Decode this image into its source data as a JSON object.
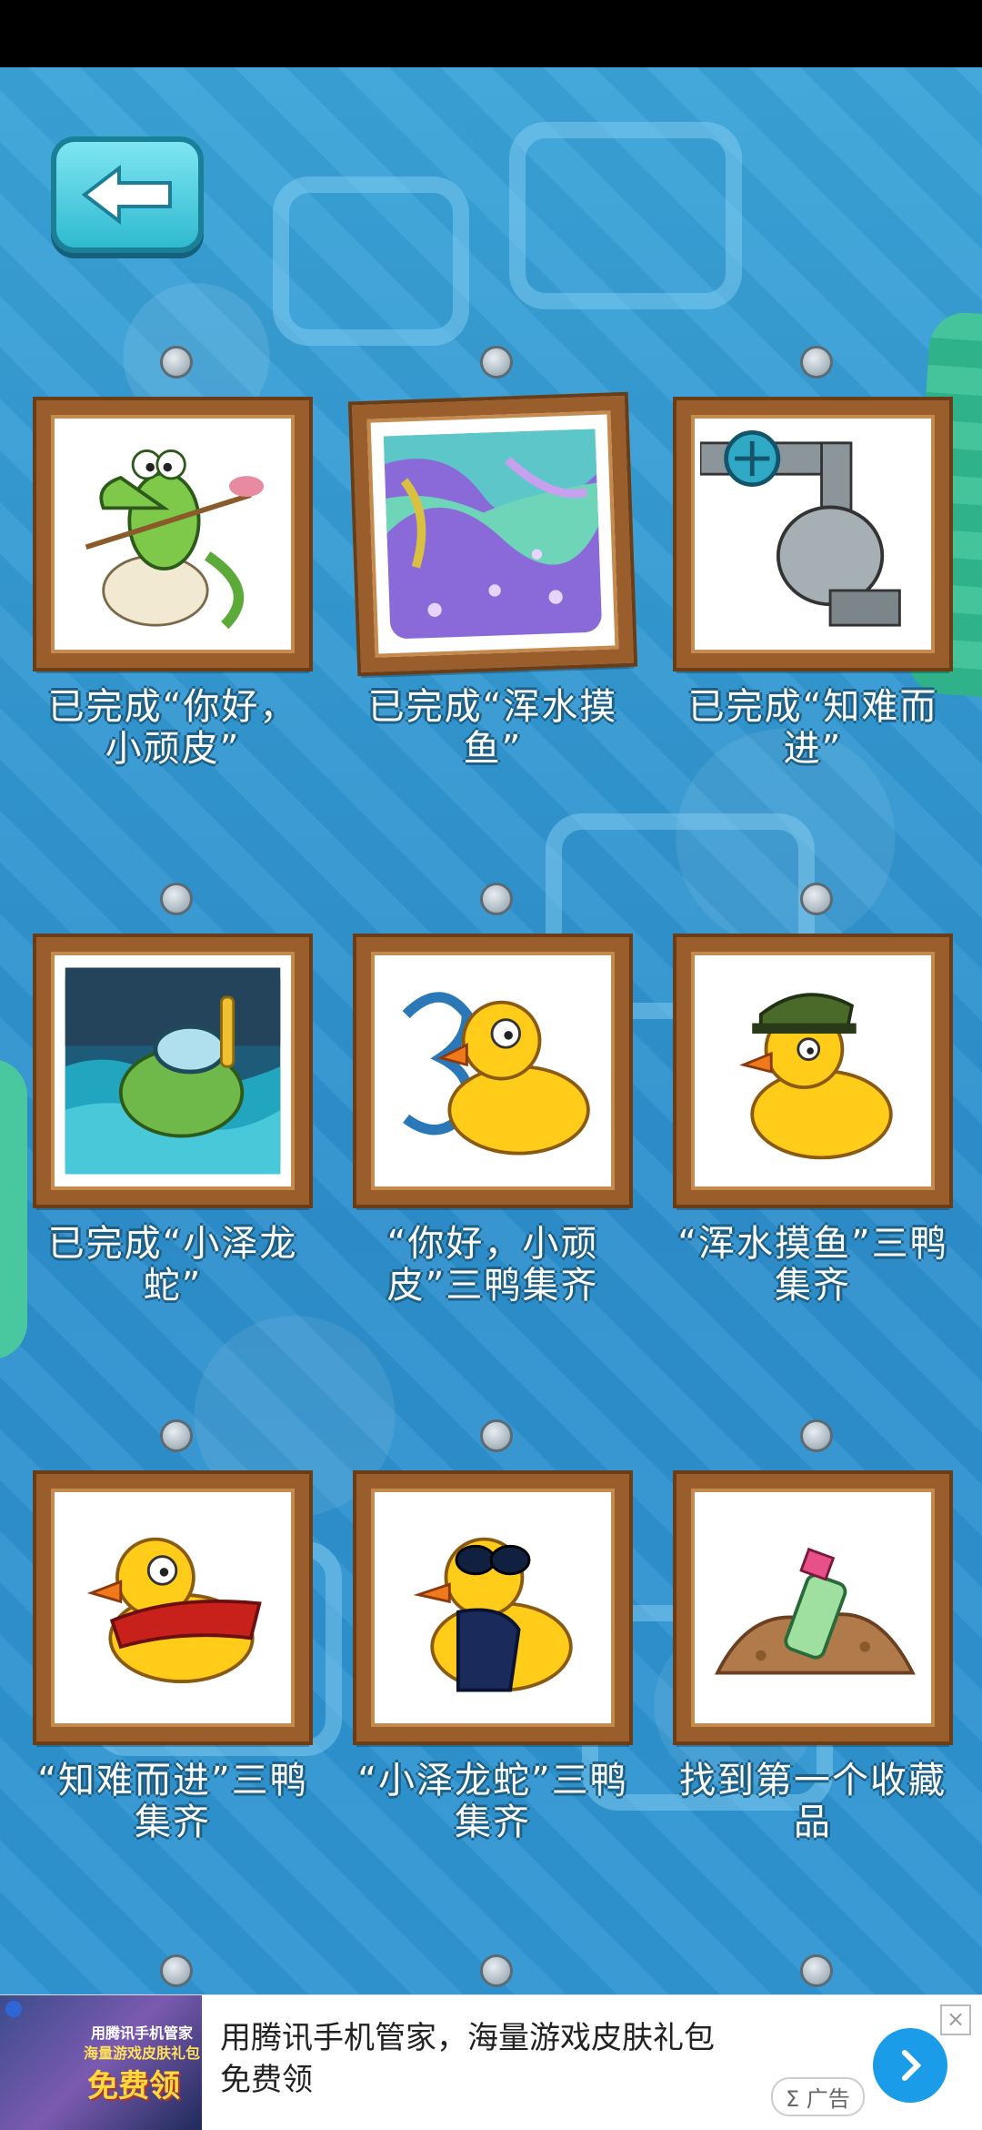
{
  "achievements": [
    {
      "caption": "已完成“你好，小顽皮”",
      "art": "crocodile-swampy"
    },
    {
      "caption": "已完成“浑水摸鱼”",
      "art": "water-level"
    },
    {
      "caption": "已完成“知难而进”",
      "art": "pipe-valve"
    },
    {
      "caption": "已完成“小泽龙蛇”",
      "art": "crocodile-snorkel"
    },
    {
      "caption": "“你好，小顽皮”三鸭集齐",
      "art": "duck-three"
    },
    {
      "caption": "“浑水摸鱼”三鸭集齐",
      "art": "duck-soldier"
    },
    {
      "caption": "“知难而进”三鸭集齐",
      "art": "duck-cape"
    },
    {
      "caption": "“小泽龙蛇”三鸭集齐",
      "art": "duck-sunglasses"
    },
    {
      "caption": "找到第一个收藏品",
      "art": "collectible-bottle"
    }
  ],
  "ad": {
    "image_line1": "用腾讯手机管家",
    "image_line2": "海量游戏皮肤礼包",
    "image_line3": "免费领",
    "text": "用腾讯手机管家，海量游戏皮肤礼包免费领",
    "label": "Σ 广告",
    "close": "×"
  },
  "colors": {
    "frame": "#9a5e2c",
    "water": "#2d8fcc",
    "button": "#2fbad0"
  }
}
